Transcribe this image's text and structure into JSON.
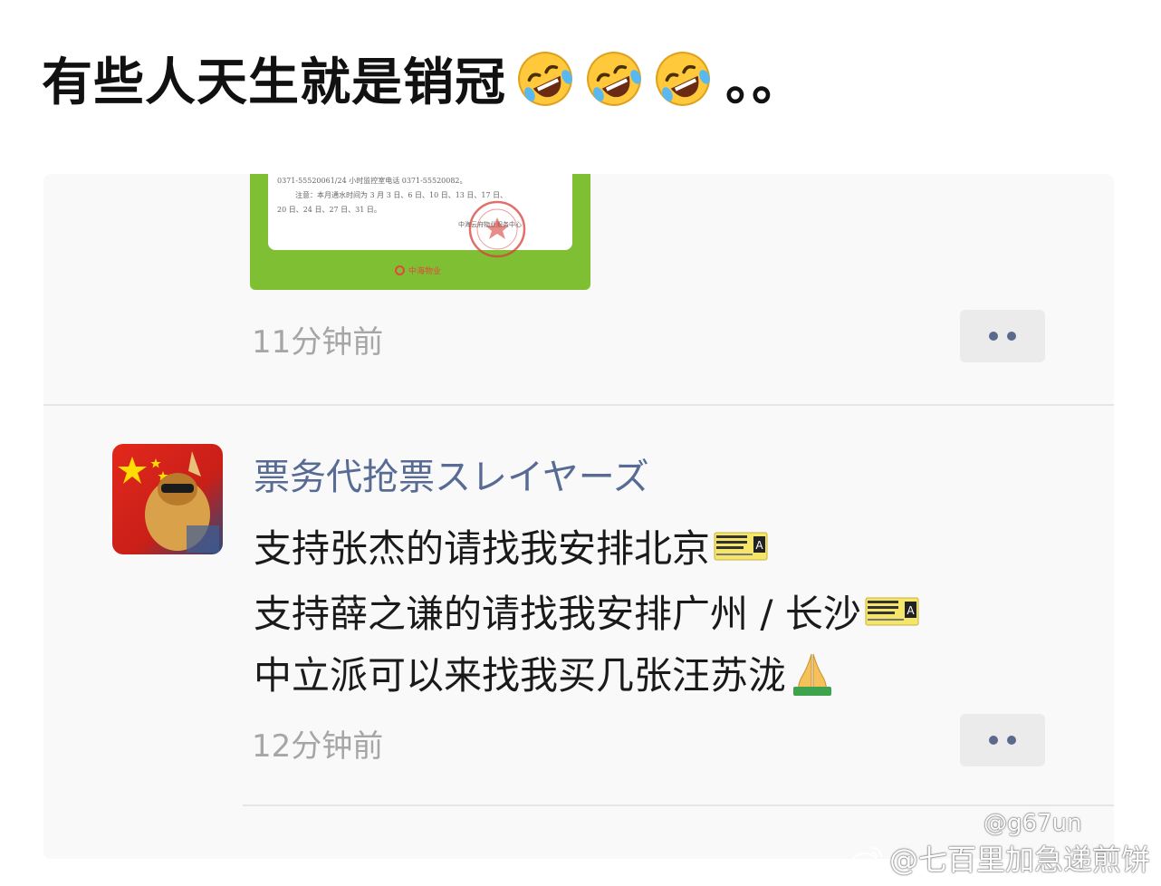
{
  "headline": {
    "text": "有些人天生就是销冠",
    "emojis": [
      "rolling-on-floor-laughing-emoji",
      "rolling-on-floor-laughing-emoji",
      "rolling-on-floor-laughing-emoji"
    ],
    "tail": "。。"
  },
  "first_post": {
    "notice_lines": [
      "0371-55520061/24 小时监控室电话 0371-55520082。",
      "注意：本月通水时间为 3 月 3 日、6 日、10 日、13 日、17 日、",
      "20 日、24 日、27 日、31 日。",
      "中海云府物业服务中心"
    ],
    "notice_footer": "中海物业",
    "time": "11分钟前",
    "more_icon": "two-dots-more-icon"
  },
  "second_post": {
    "author": "票务代抢票スレイヤーズ",
    "lines": [
      "支持张杰的请找我安排北京",
      "支持薛之谦的请找我安排广州 / 长沙",
      "中立派可以来找我买几张汪苏泷"
    ],
    "line_icons": [
      "ticket-emoji",
      "ticket-emoji",
      "folded-hands-emoji"
    ],
    "time": "12分钟前",
    "more_icon": "two-dots-more-icon"
  },
  "watermark": {
    "handle": "@g67un",
    "name": "@七百里加急递煎饼"
  },
  "colors": {
    "author_link": "#576b95",
    "timestamp": "#a6a6a6",
    "card_background": "#f9f9f9",
    "notice_green": "#7fbf34"
  }
}
